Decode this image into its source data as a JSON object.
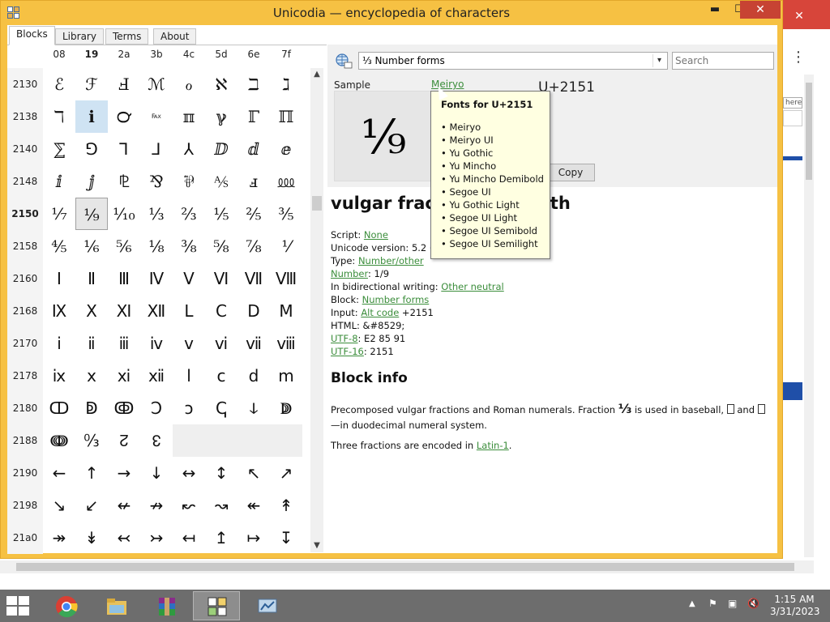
{
  "window": {
    "title": "Unicodia — encyclopedia of characters",
    "min_glyph": "▬",
    "max_glyph": "☐",
    "close_glyph": "✕"
  },
  "background_window": {
    "close_glyph": "✕",
    "kebab_glyph": "⋮",
    "field_text": "here"
  },
  "tabs": [
    {
      "label": "Blocks",
      "active": true
    },
    {
      "label": "Library",
      "active": false
    },
    {
      "label": "Terms",
      "active": false
    },
    {
      "label": "About",
      "active": false
    }
  ],
  "grid": {
    "col_headers": [
      "08",
      "19",
      "2a",
      "3b",
      "4c",
      "5d",
      "6e",
      "7f"
    ],
    "rows": [
      {
        "label": "2130",
        "chars": [
          "ℰ",
          "ℱ",
          "Ⅎ",
          "ℳ",
          "ℴ",
          "ℵ",
          "ℶ",
          "ℷ"
        ]
      },
      {
        "label": "2138",
        "chars": [
          "ℸ",
          "ℹ",
          "℺",
          "℻",
          "ℼ",
          "ℽ",
          "ℾ",
          "ℿ"
        ]
      },
      {
        "label": "2140",
        "chars": [
          "⅀",
          "⅁",
          "⅂",
          "⅃",
          "⅄",
          "ⅅ",
          "ⅆ",
          "ⅇ"
        ]
      },
      {
        "label": "2148",
        "chars": [
          "ⅈ",
          "ⅉ",
          "⅊",
          "⅋",
          "⅌",
          "⅍",
          "ⅎ",
          "⅏"
        ]
      },
      {
        "label": "2150",
        "chars": [
          "⅐",
          "⅑",
          "⅒",
          "⅓",
          "⅔",
          "⅕",
          "⅖",
          "⅗"
        ]
      },
      {
        "label": "2158",
        "chars": [
          "⅘",
          "⅙",
          "⅚",
          "⅛",
          "⅜",
          "⅝",
          "⅞",
          "⅟"
        ]
      },
      {
        "label": "2160",
        "chars": [
          "Ⅰ",
          "Ⅱ",
          "Ⅲ",
          "Ⅳ",
          "Ⅴ",
          "Ⅵ",
          "Ⅶ",
          "Ⅷ"
        ]
      },
      {
        "label": "2168",
        "chars": [
          "Ⅸ",
          "Ⅹ",
          "Ⅺ",
          "Ⅻ",
          "Ⅼ",
          "Ⅽ",
          "Ⅾ",
          "Ⅿ"
        ]
      },
      {
        "label": "2170",
        "chars": [
          "ⅰ",
          "ⅱ",
          "ⅲ",
          "ⅳ",
          "ⅴ",
          "ⅵ",
          "ⅶ",
          "ⅷ"
        ]
      },
      {
        "label": "2178",
        "chars": [
          "ⅸ",
          "ⅹ",
          "ⅺ",
          "ⅻ",
          "ⅼ",
          "ⅽ",
          "ⅾ",
          "ⅿ"
        ]
      },
      {
        "label": "2180",
        "chars": [
          "ↀ",
          "ↁ",
          "ↂ",
          "Ↄ",
          "ↄ",
          "ↅ",
          "ↆ",
          "ↇ"
        ]
      },
      {
        "label": "2188",
        "chars": [
          "ↈ",
          "↉",
          "↊",
          "↋",
          "",
          "",
          "",
          ""
        ]
      },
      {
        "label": "2190",
        "chars": [
          "←",
          "↑",
          "→",
          "↓",
          "↔",
          "↕",
          "↖",
          "↗"
        ]
      },
      {
        "label": "2198",
        "chars": [
          "↘",
          "↙",
          "↚",
          "↛",
          "↜",
          "↝",
          "↞",
          "↟"
        ]
      },
      {
        "label": "21a0",
        "chars": [
          "↠",
          "↡",
          "↢",
          "↣",
          "↤",
          "↥",
          "↦",
          "↧"
        ]
      }
    ],
    "scroll_up": "▲",
    "scroll_down": "▼"
  },
  "toolbar": {
    "block_name": "⅓ Number forms",
    "search_placeholder": "Search",
    "chevron": "▾"
  },
  "sample": {
    "label": "Sample",
    "glyph": "⅑",
    "font_link": "Meiryo",
    "codepoint": "U+2151",
    "copy_label": "Copy"
  },
  "details": {
    "name": "vulgar fraction one ninth",
    "script_label": "Script: ",
    "script_value": "None",
    "version_label": "Unicode version: 5.2 (October 2009)",
    "type_label": "Type: ",
    "type_value": "Number/other",
    "number_link": "Number",
    "number_value": ": 1/9",
    "bidi_label": "In bidirectional writing: ",
    "bidi_value": "Other neutral",
    "block_label": "Block: ",
    "block_value": "Number forms",
    "input_label": "Input: ",
    "input_link": "Alt code",
    "input_value": " +2151",
    "html_label": "HTML: &#8529;",
    "utf8_link": "UTF-8",
    "utf8_value": ": E2 85 91",
    "utf16_link": "UTF-16",
    "utf16_value": ": 2151",
    "block_info_heading": "Block info",
    "para1_a": "Precomposed vulgar fractions and Roman numerals. Fraction ",
    "para1_glyph": "⅓",
    "para1_b": " is used in baseball, ",
    "para1_c": " and ",
    "para1_d": " —in duodecimal numeral system.",
    "para2_a": "Three fractions are encoded in ",
    "para2_link": "Latin-1",
    "para2_b": "."
  },
  "tooltip": {
    "title": "Fonts for U+2151",
    "fonts": [
      "• Meiryo",
      "• Meiryo UI",
      "• Yu Gothic",
      "• Yu Mincho",
      "• Yu Mincho Demibold",
      "• Segoe UI",
      "• Yu Gothic Light",
      "• Segoe UI Light",
      "• Segoe UI Semibold",
      "• Segoe UI Semilight"
    ]
  },
  "taskbar": {
    "time": "1:15 AM",
    "date": "3/31/2023",
    "tray_icons": [
      "▲",
      "⚑",
      "▣",
      "🔇"
    ]
  },
  "colors": {
    "accent_window": "#f6c143",
    "link": "#3b8d3b",
    "close_red": "#c74333"
  }
}
